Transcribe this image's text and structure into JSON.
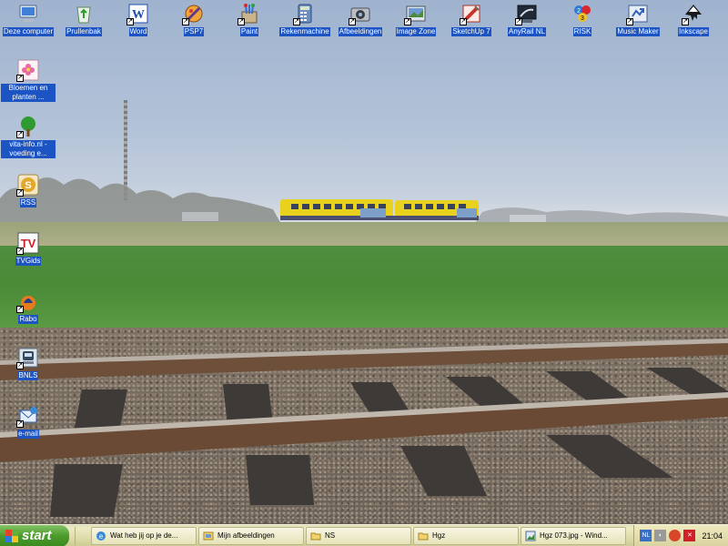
{
  "desktop_icons": [
    {
      "label": "Deze computer",
      "icon": "my-computer-icon"
    },
    {
      "label": "Prullenbak",
      "icon": "recycle-bin-icon"
    },
    {
      "label": "Word",
      "icon": "word-icon"
    },
    {
      "label": "PSP7",
      "icon": "psp-icon"
    },
    {
      "label": "Paint",
      "icon": "paint-icon"
    },
    {
      "label": "Rekenmachine",
      "icon": "calculator-icon"
    },
    {
      "label": "Afbeeldingen",
      "icon": "camera-icon"
    },
    {
      "label": "Image Zone",
      "icon": "image-zone-icon"
    },
    {
      "label": "SketchUp 7",
      "icon": "sketchup-icon"
    },
    {
      "label": "AnyRail NL",
      "icon": "anyrail-icon"
    },
    {
      "label": "RISK",
      "icon": "risk-icon"
    },
    {
      "label": "Music Maker",
      "icon": "music-maker-icon"
    },
    {
      "label": "Inkscape",
      "icon": "inkscape-icon"
    },
    {
      "label": "Bloemen en planten ...",
      "icon": "flower-icon"
    },
    {
      "label": "vita-info.nl - voeding e...",
      "icon": "tree-icon"
    },
    {
      "label": "RSS",
      "icon": "rss-icon"
    },
    {
      "label": "TVGids",
      "icon": "tv-icon"
    },
    {
      "label": "Rabo",
      "icon": "rabo-icon"
    },
    {
      "label": "BNLS",
      "icon": "bnls-icon"
    },
    {
      "label": "e-mail",
      "icon": "email-icon"
    }
  ],
  "taskbar": {
    "start_label": "start",
    "tasks": [
      {
        "label": "Wat heb jij op je de...",
        "icon": "ie-icon"
      },
      {
        "label": "Mijn afbeeldingen",
        "icon": "folder-window-icon"
      },
      {
        "label": "NS",
        "icon": "folder-icon"
      },
      {
        "label": "Hgz",
        "icon": "folder-icon"
      },
      {
        "label": "Hgz 073.jpg - Wind...",
        "icon": "image-viewer-icon"
      }
    ],
    "tray_lang": "NL",
    "clock": "21:04"
  },
  "colors": {
    "label_bg": "#1d54c4",
    "train_yellow": "#e8d21e",
    "taskbar": "#e2e0b0",
    "start_green": "#4c9a2c"
  }
}
